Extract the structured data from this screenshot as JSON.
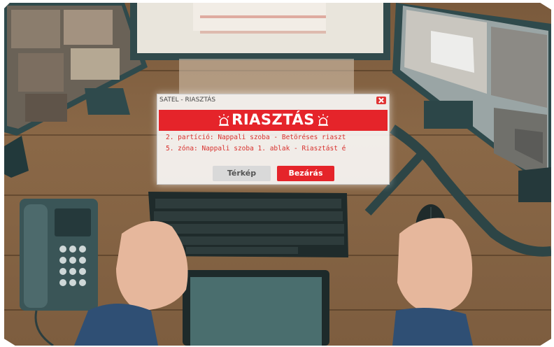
{
  "scene": {
    "description_icons": [
      "monitor-left",
      "monitor-center",
      "monitor-right",
      "keyboard",
      "mouse",
      "desk-phone",
      "tablet",
      "hands"
    ]
  },
  "alarm_window": {
    "title": "SATEL - RIASZTÁS",
    "heading": "RIASZTÁS",
    "message_lines": [
      "2. partíció: Nappali szoba - Betöréses riaszt",
      "5. zóna: Nappali szoba 1. ablak - Riasztást é"
    ],
    "buttons": {
      "map_label": "Térkép",
      "close_label": "Bezárás"
    },
    "colors": {
      "accent": "#e5242a",
      "text": "#d8302c"
    }
  }
}
